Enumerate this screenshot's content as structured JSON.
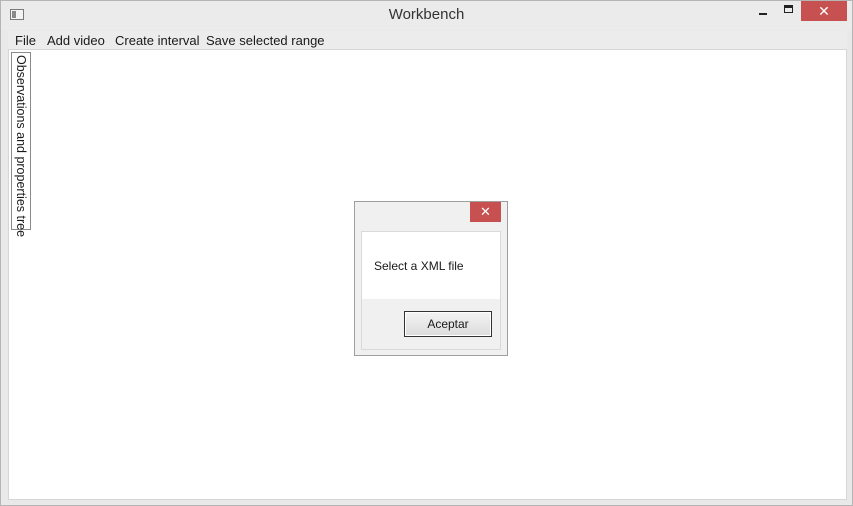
{
  "window": {
    "title": "Workbench",
    "close_glyph": "✕"
  },
  "menu": {
    "items": [
      "File",
      "Add video",
      "Create interval",
      "Save selected range"
    ]
  },
  "side_panel": {
    "tab_label": "Observations and properties tree"
  },
  "dialog": {
    "close_glyph": "✕",
    "message": "Select a XML file",
    "ok_label": "Aceptar"
  },
  "colors": {
    "close_button": "#c75050",
    "title_bar": "#ebebeb",
    "client_background": "#ffffff"
  }
}
